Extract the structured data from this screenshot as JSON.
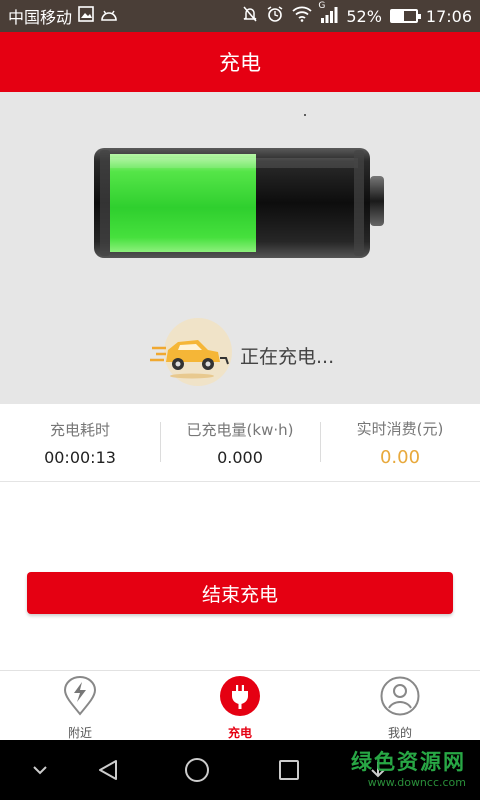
{
  "status_bar": {
    "carrier": "中国移动",
    "battery_percent": "52%",
    "battery_level": 0.52,
    "time": "17:06",
    "network_letter": "G",
    "icons": [
      "gallery-icon",
      "android-icon",
      "mute-icon",
      "alarm-icon",
      "wifi-icon",
      "signal-icon",
      "battery-icon"
    ]
  },
  "header": {
    "title": "充电"
  },
  "hero": {
    "status_text": "正在充电...",
    "charge_fill": 0.5,
    "colors": {
      "fill": "#3fd94a",
      "body": "#1a1a1a",
      "bg": "#e6e6e6"
    }
  },
  "stats": [
    {
      "label": "充电耗时",
      "value": "00:00:13"
    },
    {
      "label": "已充电量(kw·h)",
      "value": "0.000"
    },
    {
      "label": "实时消费(元)",
      "value": "0.00"
    }
  ],
  "actions": {
    "end_label": "结束充电"
  },
  "tabs": [
    {
      "label": "附近",
      "icon": "location-pin-bolt-icon",
      "active": false
    },
    {
      "label": "充电",
      "icon": "plug-icon",
      "active": true
    },
    {
      "label": "我的",
      "icon": "user-icon",
      "active": false
    }
  ],
  "watermark": {
    "title": "绿色资源网",
    "url": "www.downcc.com"
  },
  "colors": {
    "primary": "#e50012",
    "status_bar": "#4a3e37",
    "cost": "#e8a93c"
  }
}
